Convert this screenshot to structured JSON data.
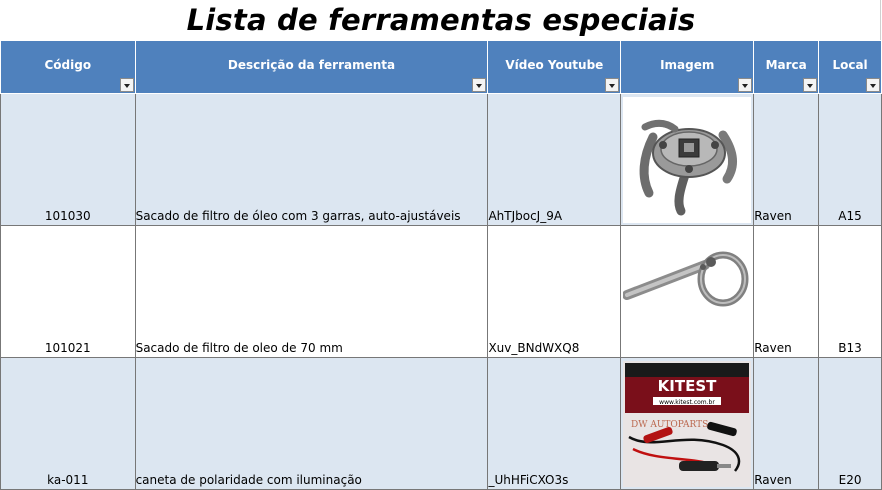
{
  "title": "Lista de ferramentas especiais",
  "headers": {
    "codigo": "Código",
    "descricao": "Descrição da ferramenta",
    "video": "Vídeo Youtube",
    "imagem": "Imagem",
    "marca": "Marca",
    "local": "Local"
  },
  "rows": [
    {
      "codigo": "101030",
      "descricao": "Sacado de filtro de óleo com 3 garras, auto-ajustáveis",
      "video": "AhTJbocJ_9A",
      "image_icon": "oil-filter-wrench-3-jaw-image",
      "marca": "Raven",
      "local": "A15"
    },
    {
      "codigo": "101021",
      "descricao": "Sacado de filtro de oleo de 70 mm",
      "video": "Xuv_BNdWXQ8",
      "image_icon": "oil-filter-strap-wrench-image",
      "marca": "Raven",
      "local": "B13"
    },
    {
      "codigo": "ka-011",
      "descricao": "caneta de polaridade com iluminação",
      "video": "_UhHFiCXO3s",
      "image_icon": "polarity-tester-kit-image",
      "marca": "Raven",
      "local": "E20",
      "image_text": {
        "brand": "KITEST",
        "url": "www.kitest.com.br",
        "watermark": "DW AUTOPARTS"
      }
    }
  ],
  "colors": {
    "header_bg": "#4f81bd",
    "row_shade": "#dce6f1",
    "link": "#1f4e9a"
  }
}
